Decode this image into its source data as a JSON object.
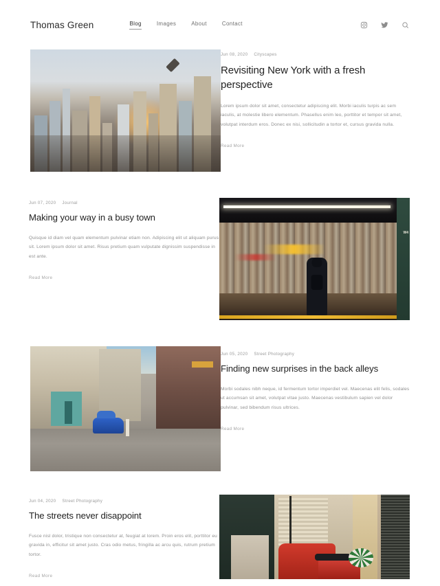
{
  "site": {
    "brand": "Thomas Green"
  },
  "nav": {
    "items": [
      {
        "label": "Blog",
        "active": true
      },
      {
        "label": "Images",
        "active": false
      },
      {
        "label": "About",
        "active": false
      },
      {
        "label": "Contact",
        "active": false
      }
    ]
  },
  "header_icons": [
    {
      "name": "instagram-icon",
      "label": "Instagram"
    },
    {
      "name": "twitter-icon",
      "label": "Twitter"
    },
    {
      "name": "search-icon",
      "label": "Search"
    }
  ],
  "posts": [
    {
      "date": "Jun 08, 2020",
      "category": "Cityscapes",
      "title": "Revisiting New York with a fresh perspective",
      "excerpt": "Lorem ipsum dolor sit amet, consectetur adipiscing elit. Morbi iaculis turpis ac sem iaculis, at molestie libero elementum. Phasellus enim leo, porttitor et tempor sit amet, volutpat interdum eros. Donec ex nisi, sollicitudin a tortor et, cursus gravida nulla.",
      "read_more": "Read More",
      "image_alt": "New York City skyline at sunset"
    },
    {
      "date": "Jun 07, 2020",
      "category": "Journal",
      "title": "Making your way in a busy town",
      "excerpt": "Quisque id diam vel quam elementum pulvinar etiam non. Adipiscing elit ut aliquam purus sit. Lorem ipsum dolor sit amet. Risus pretium quam vulputate dignissim suspendisse in est ante.",
      "read_more": "Read More",
      "image_alt": "Person on subway platform with passing train"
    },
    {
      "date": "Jun 05, 2020",
      "category": "Street Photography",
      "title": "Finding new surprises in the back alleys",
      "excerpt": "Morbi sodales nibh neque, id fermentum tortor imperdiet vel. Maecenas elit felis, sodales ut accumsan sit amet, volutpat vitae justo. Maecenas vestibulum sapien vel dolor pulvinar, sed bibendum risus ultrices.",
      "read_more": "Read More",
      "image_alt": "Havana street with blue vintage car"
    },
    {
      "date": "Jun 04, 2020",
      "category": "Street Photography",
      "title": "The streets never disappoint",
      "excerpt": "Fusce nisl dolor, tristique non consectetur at, feugiat at lorem. Proin eros elit, porttitor eu gravida in, efficitur sit amet justo. Cras odio metus, fringilla ac arcu quis, rutrum pretium tortor.",
      "read_more": "Read More",
      "image_alt": "Red scooter parked against a weathered wall"
    }
  ],
  "subway_sign_text": "W4",
  "colors": {
    "text_primary": "#222222",
    "text_muted": "#8e8e8e",
    "meta": "#9b9b9b",
    "background": "#ffffff"
  }
}
